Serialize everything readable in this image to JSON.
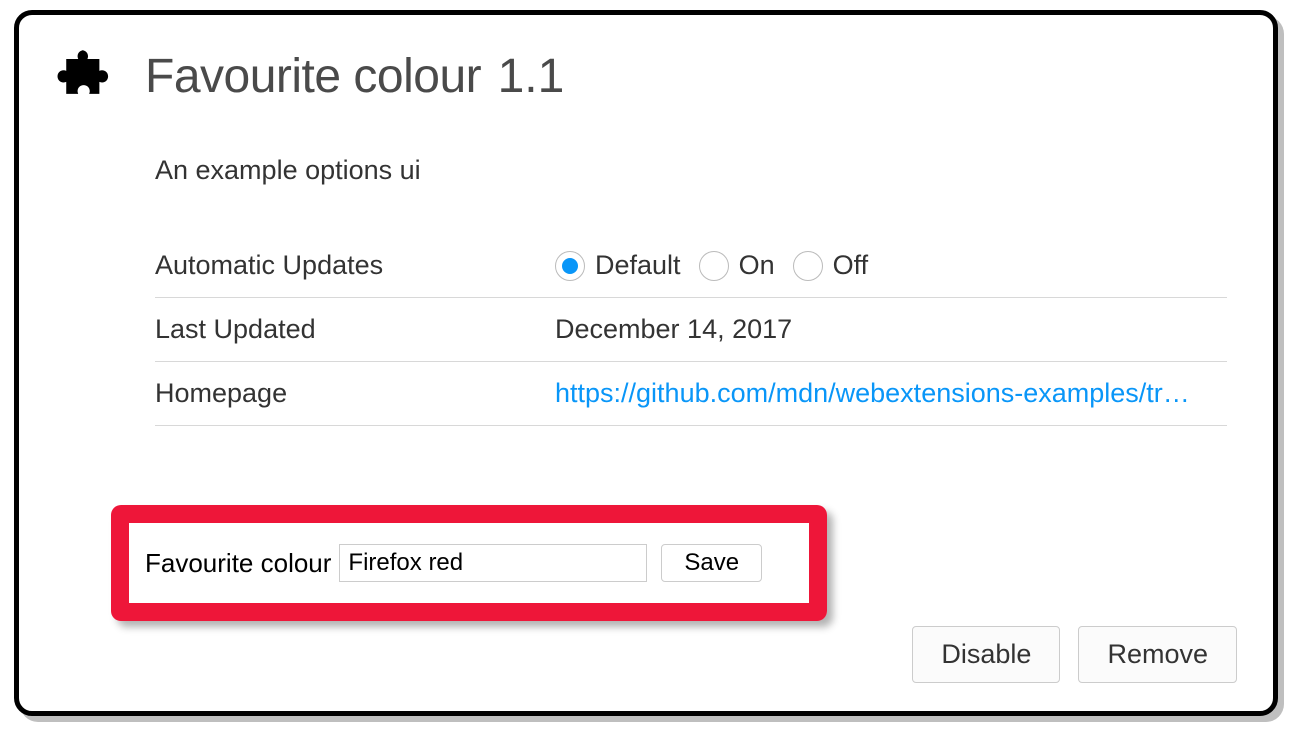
{
  "header": {
    "title": "Favourite colour",
    "version": "1.1"
  },
  "description": "An example options ui",
  "info": {
    "automatic_updates_label": "Automatic Updates",
    "updates_options": {
      "default": "Default",
      "on": "On",
      "off": "Off"
    },
    "last_updated_label": "Last Updated",
    "last_updated_value": "December 14, 2017",
    "homepage_label": "Homepage",
    "homepage_url": "https://github.com/mdn/webextensions-examples/tr…"
  },
  "options_form": {
    "field_label": "Favourite colour",
    "field_value": "Firefox red",
    "save_label": "Save"
  },
  "footer": {
    "disable_label": "Disable",
    "remove_label": "Remove"
  }
}
